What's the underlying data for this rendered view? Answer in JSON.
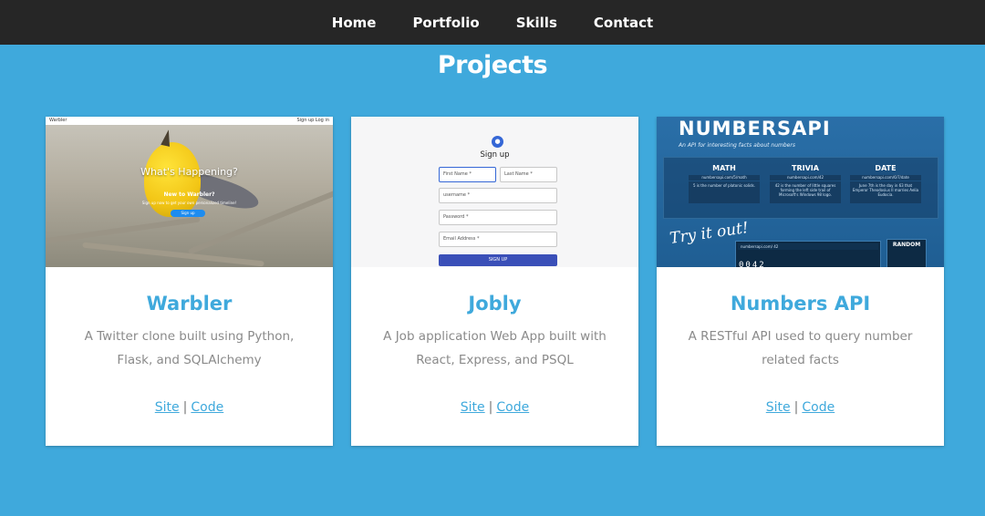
{
  "nav": {
    "items": [
      {
        "label": "Home"
      },
      {
        "label": "Portfolio"
      },
      {
        "label": "Skills"
      },
      {
        "label": "Contact"
      }
    ]
  },
  "page_title": "Projects",
  "projects": [
    {
      "title": "Warbler",
      "description": "A Twitter clone built using Python, Flask, and SQLAlchemy",
      "site_label": "Site",
      "code_label": "Code",
      "screenshot": {
        "logo": "Warbler",
        "top_links": "Sign up   Log in",
        "headline": "What's Happening?",
        "sub1": "New to Warbler?",
        "sub2": "Sign up now to get your own personalized timeline!",
        "button": "Sign up"
      }
    },
    {
      "title": "Jobly",
      "description": "A Job application Web App built with React, Express, and PSQL",
      "site_label": "Site",
      "code_label": "Code",
      "screenshot": {
        "heading": "Sign up",
        "first_name": "First Name *",
        "last_name": "Last Name *",
        "username": "username *",
        "password": "Password *",
        "email": "Email Address *",
        "button": "SIGN UP"
      }
    },
    {
      "title": "Numbers API",
      "description": "A RESTful API used to query number related facts",
      "site_label": "Site",
      "code_label": "Code",
      "screenshot": {
        "logo": "NUMBERSAPI",
        "tagline": "An API for interesting facts about numbers",
        "cols": [
          {
            "head": "MATH",
            "url": "numbersapi.com/5/math",
            "fact": "5 is the number of platonic solids."
          },
          {
            "head": "TRIVIA",
            "url": "numbersapi.com/42",
            "fact": "42 is the number of little squares forming the left side trail of Microsoft's Windows 98 logo."
          },
          {
            "head": "DATE",
            "url": "numbersapi.com/6/7/date",
            "fact": "June 7th is the day in 63 that Emperor Theodosius II marries Aelia Eudocia."
          }
        ],
        "try": "Try it out!",
        "try_url": "numbersapi.com/ 42",
        "digits": "0042",
        "random_label": "RANDOM"
      }
    }
  ],
  "colors": {
    "background": "#3fa9dc",
    "nav": "#262626",
    "accent": "#3fa9dc"
  }
}
